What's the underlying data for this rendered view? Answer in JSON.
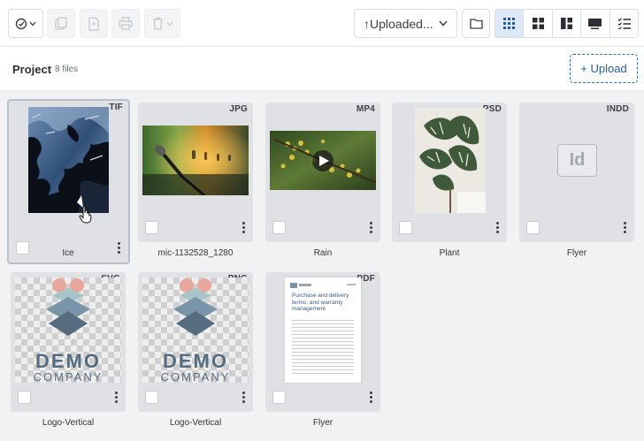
{
  "toolbar": {
    "sort_label": "↑Uploaded...",
    "icons": [
      "select-check-icon",
      "copy-icon",
      "duplicate-icon",
      "print-icon",
      "delete-icon",
      "folder-icon",
      "grid-small-icon",
      "grid-large-icon",
      "masonry-icon",
      "presentation-icon",
      "list-icon"
    ]
  },
  "project": {
    "title": "Project",
    "count": "8 files",
    "upload_label": "+ Upload"
  },
  "files": [
    {
      "name": "Ice",
      "type": "TIF"
    },
    {
      "name": "mic-1132528_1280",
      "type": "JPG"
    },
    {
      "name": "Rain",
      "type": "MP4"
    },
    {
      "name": "Plant",
      "type": "PSD"
    },
    {
      "name": "Flyer",
      "type": "INDD",
      "icon_text": "Id"
    },
    {
      "name": "Logo-Vertical",
      "type": "SVG",
      "logo_line1": "DEMO",
      "logo_line2": "COMPANY"
    },
    {
      "name": "Logo-Vertical",
      "type": "PNG",
      "logo_line1": "DEMO",
      "logo_line2": "COMPANY"
    },
    {
      "name": "Flyer",
      "type": "PDF",
      "doc_title": "Purchase and delivery terms, and warranty management"
    }
  ],
  "colors": {
    "accent": "#1e5aa8",
    "logo": "#566d80",
    "logo_pink": "#e9a79b"
  }
}
